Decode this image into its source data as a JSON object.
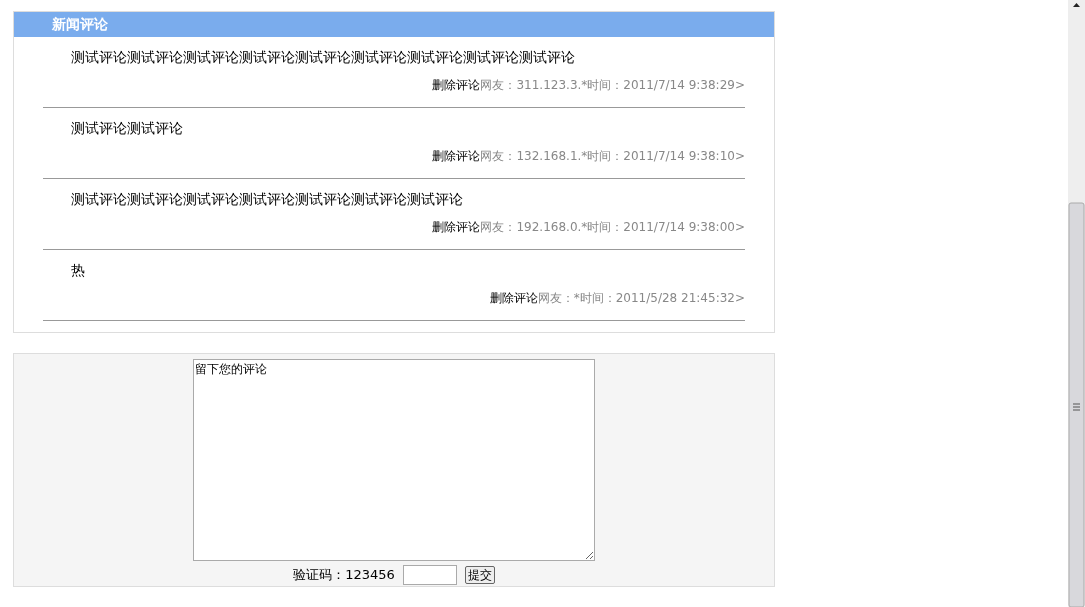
{
  "comments_panel": {
    "title": "新闻评论",
    "comments": [
      {
        "text": "测试评论测试评论测试评论测试评论测试评论测试评论测试评论测试评论测试评论",
        "delete_link": "删除评论",
        "user": "网友：311.123.3.*",
        "time": "时间：2011/7/14 9:38:29>"
      },
      {
        "text": "测试评论测试评论",
        "delete_link": "删除评论",
        "user": "网友：132.168.1.*",
        "time": "时间：2011/7/14 9:38:10>"
      },
      {
        "text": "测试评论测试评论测试评论测试评论测试评论测试评论测试评论",
        "delete_link": "删除评论",
        "user": "网友：192.168.0.*",
        "time": "时间：2011/7/14 9:38:00>"
      },
      {
        "text": "热",
        "delete_link": "删除评论",
        "user": "网友：*",
        "time": "时间：2011/5/28 21:45:32>"
      }
    ]
  },
  "comment_form": {
    "comment_value": "留下您的评论",
    "captcha_label": "验证码：123456",
    "submit_button": "提交"
  }
}
